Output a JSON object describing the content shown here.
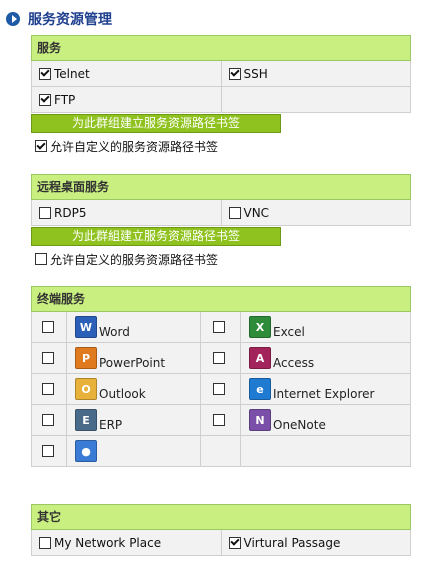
{
  "header": {
    "title": "服务资源管理"
  },
  "services": {
    "title": "服务",
    "items": [
      {
        "label": "Telnet",
        "checked": true
      },
      {
        "label": "SSH",
        "checked": true
      },
      {
        "label": "FTP",
        "checked": true
      },
      {
        "label": "",
        "checked": false
      }
    ],
    "build_label": "为此群组建立服务资源路径书签",
    "allow_label": "允许自定义的服务资源路径书签",
    "allow_checked": true
  },
  "remote": {
    "title": "远程桌面服务",
    "items": [
      {
        "label": "RDP5",
        "checked": false
      },
      {
        "label": "VNC",
        "checked": false
      }
    ],
    "build_label": "为此群組建立服务资源路径书签",
    "allow_label": "允许自定义的服务资源路径书签",
    "allow_checked": false
  },
  "terminal": {
    "title": "终端服务",
    "apps": [
      {
        "label": "Word",
        "icon": "word-icon",
        "color": "#2b5fb8",
        "glyph": "W"
      },
      {
        "label": "Excel",
        "icon": "excel-icon",
        "color": "#2e8b3a",
        "glyph": "X"
      },
      {
        "label": "PowerPoint",
        "icon": "powerpoint-icon",
        "color": "#e07a1f",
        "glyph": "P"
      },
      {
        "label": "Access",
        "icon": "access-icon",
        "color": "#a3245a",
        "glyph": "A"
      },
      {
        "label": "Outlook",
        "icon": "outlook-icon",
        "color": "#e8b23a",
        "glyph": "O"
      },
      {
        "label": "Internet Explorer",
        "icon": "internet-explorer-icon",
        "color": "#1f7ad1",
        "glyph": "e"
      },
      {
        "label": "ERP",
        "icon": "erp-icon",
        "color": "#4a6a8a",
        "glyph": "E"
      },
      {
        "label": "OneNote",
        "icon": "onenote-icon",
        "color": "#7a4fa8",
        "glyph": "N"
      },
      {
        "label": "",
        "icon": "generic-app-icon",
        "color": "#3a7bd5",
        "glyph": "●"
      }
    ]
  },
  "other": {
    "title": "其它",
    "items": [
      {
        "label": "My Network Place",
        "checked": false
      },
      {
        "label": "Virtural Passage",
        "checked": true
      }
    ]
  }
}
